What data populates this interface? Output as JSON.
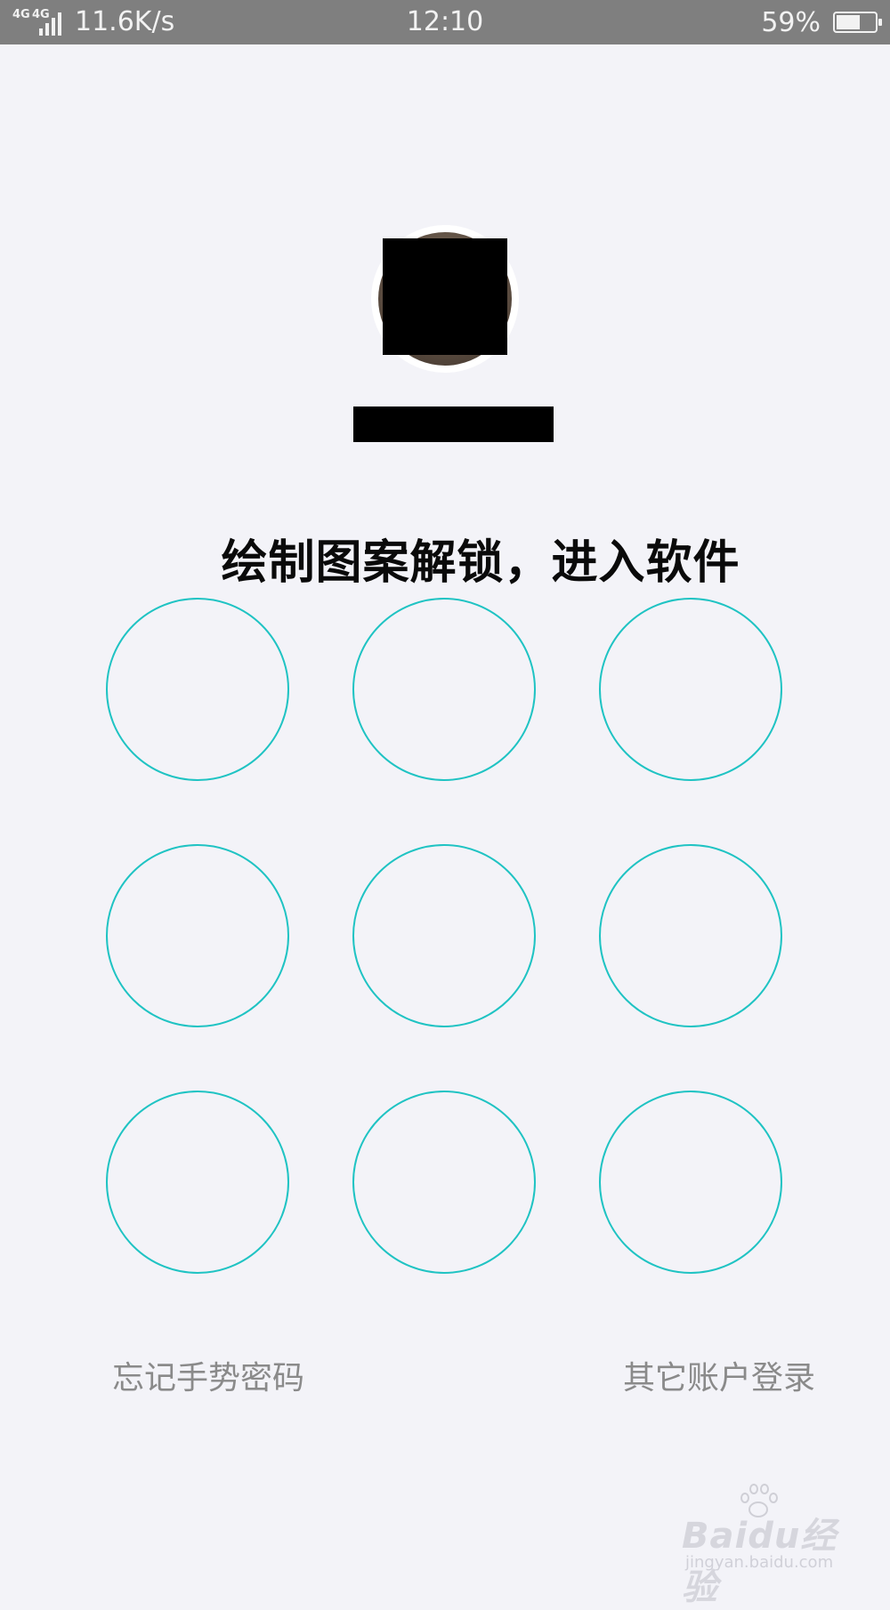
{
  "status_bar": {
    "network_tag_1": "4G",
    "network_tag_2": "4G",
    "speed": "11.6K/s",
    "time": "12:10",
    "battery_percent": "59%",
    "battery_level": 0.59
  },
  "unlock": {
    "prompt": "绘制图案解锁，进入软件",
    "pattern_dot_count": 9,
    "accent_color": "#1fc3c3"
  },
  "links": {
    "forgot": "忘记手势密码",
    "other_account": "其它账户登录"
  },
  "watermark": {
    "logo": "Baidu经验",
    "url": "jingyan.baidu.com"
  }
}
